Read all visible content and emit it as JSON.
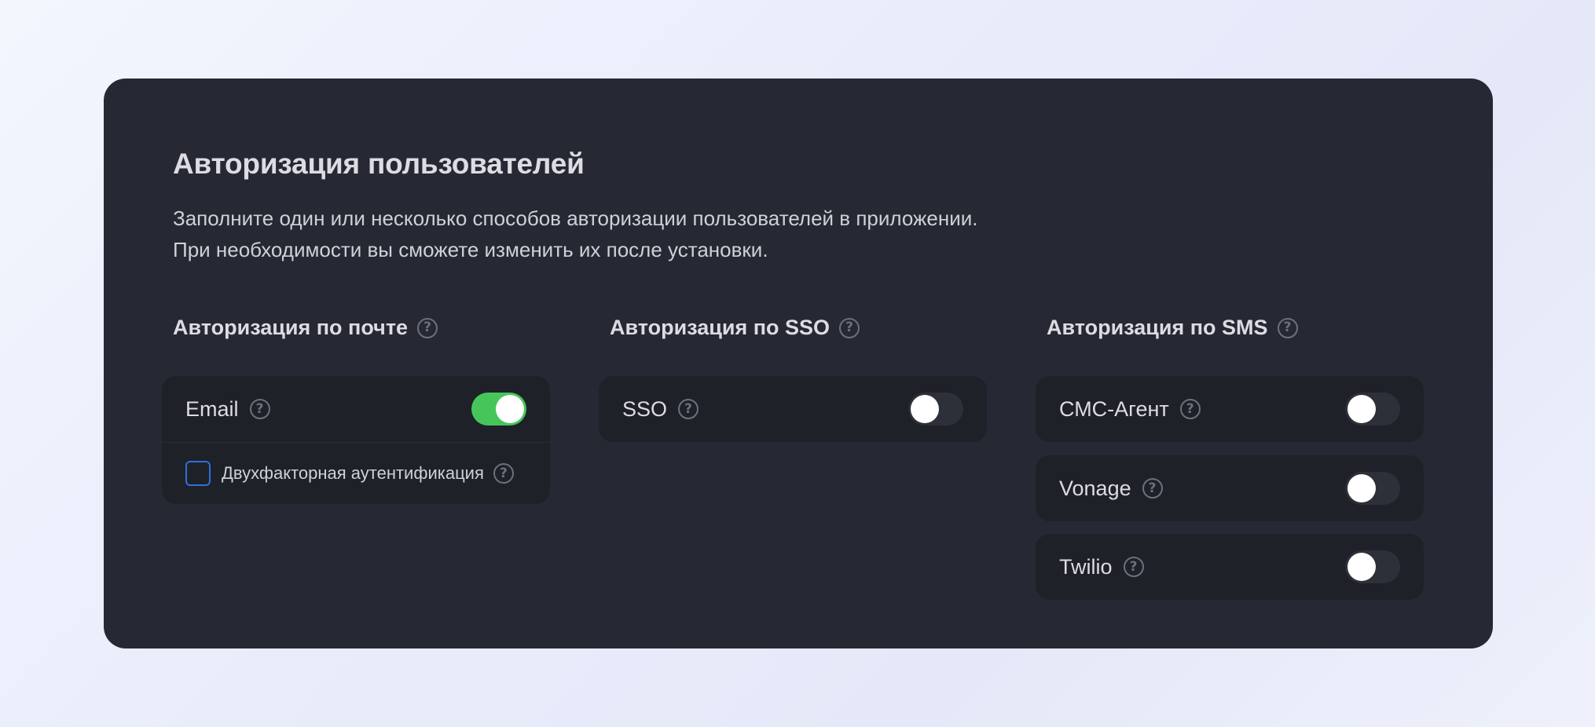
{
  "header": {
    "title": "Авторизация пользователей",
    "description_line1": "Заполните один или несколько способов авторизации пользователей в приложении.",
    "description_line2": "При необходимости вы сможете изменить их после установки."
  },
  "sections": {
    "email": {
      "title": "Авторизация по почте",
      "items": [
        {
          "label": "Email",
          "enabled": true
        }
      ],
      "two_factor": {
        "label": "Двухфакторная аутентификация",
        "checked": false
      }
    },
    "sso": {
      "title": "Авторизация по SSO",
      "items": [
        {
          "label": "SSO",
          "enabled": false
        }
      ]
    },
    "sms": {
      "title": "Авторизация по SMS",
      "items": [
        {
          "label": "СМС-Агент",
          "enabled": false
        },
        {
          "label": "Vonage",
          "enabled": false
        },
        {
          "label": "Twilio",
          "enabled": false
        }
      ]
    }
  },
  "icons": {
    "help": "help-icon",
    "help_glyph": "?"
  },
  "colors": {
    "toggle_on": "#46c65a",
    "toggle_off": "#2d2f39",
    "checkbox_border": "#2e6fe0",
    "card_bg": "#262833"
  }
}
